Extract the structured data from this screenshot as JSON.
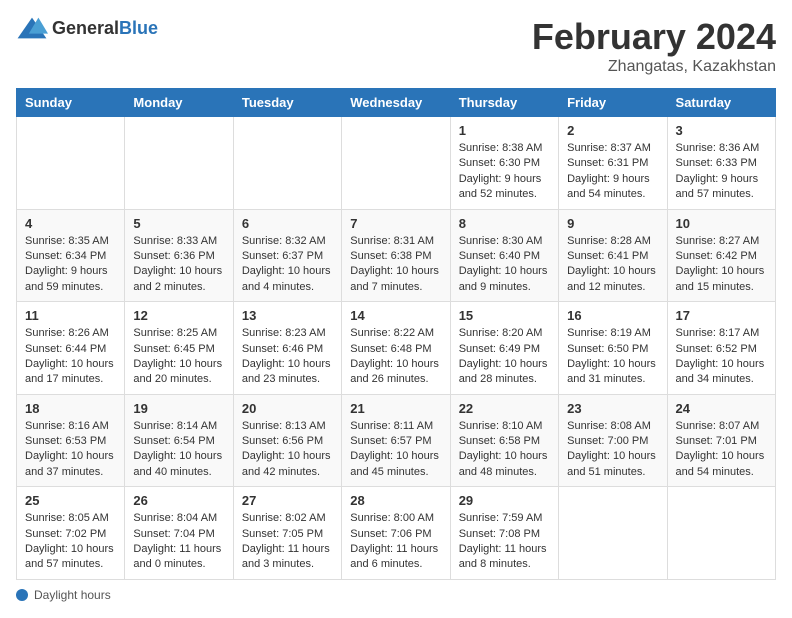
{
  "header": {
    "logo_general": "General",
    "logo_blue": "Blue",
    "title": "February 2024",
    "location": "Zhangatas, Kazakhstan"
  },
  "calendar": {
    "days_of_week": [
      "Sunday",
      "Monday",
      "Tuesday",
      "Wednesday",
      "Thursday",
      "Friday",
      "Saturday"
    ],
    "weeks": [
      [
        {
          "day": "",
          "info": ""
        },
        {
          "day": "",
          "info": ""
        },
        {
          "day": "",
          "info": ""
        },
        {
          "day": "",
          "info": ""
        },
        {
          "day": "1",
          "info": "Sunrise: 8:38 AM\nSunset: 6:30 PM\nDaylight: 9 hours and 52 minutes."
        },
        {
          "day": "2",
          "info": "Sunrise: 8:37 AM\nSunset: 6:31 PM\nDaylight: 9 hours and 54 minutes."
        },
        {
          "day": "3",
          "info": "Sunrise: 8:36 AM\nSunset: 6:33 PM\nDaylight: 9 hours and 57 minutes."
        }
      ],
      [
        {
          "day": "4",
          "info": "Sunrise: 8:35 AM\nSunset: 6:34 PM\nDaylight: 9 hours and 59 minutes."
        },
        {
          "day": "5",
          "info": "Sunrise: 8:33 AM\nSunset: 6:36 PM\nDaylight: 10 hours and 2 minutes."
        },
        {
          "day": "6",
          "info": "Sunrise: 8:32 AM\nSunset: 6:37 PM\nDaylight: 10 hours and 4 minutes."
        },
        {
          "day": "7",
          "info": "Sunrise: 8:31 AM\nSunset: 6:38 PM\nDaylight: 10 hours and 7 minutes."
        },
        {
          "day": "8",
          "info": "Sunrise: 8:30 AM\nSunset: 6:40 PM\nDaylight: 10 hours and 9 minutes."
        },
        {
          "day": "9",
          "info": "Sunrise: 8:28 AM\nSunset: 6:41 PM\nDaylight: 10 hours and 12 minutes."
        },
        {
          "day": "10",
          "info": "Sunrise: 8:27 AM\nSunset: 6:42 PM\nDaylight: 10 hours and 15 minutes."
        }
      ],
      [
        {
          "day": "11",
          "info": "Sunrise: 8:26 AM\nSunset: 6:44 PM\nDaylight: 10 hours and 17 minutes."
        },
        {
          "day": "12",
          "info": "Sunrise: 8:25 AM\nSunset: 6:45 PM\nDaylight: 10 hours and 20 minutes."
        },
        {
          "day": "13",
          "info": "Sunrise: 8:23 AM\nSunset: 6:46 PM\nDaylight: 10 hours and 23 minutes."
        },
        {
          "day": "14",
          "info": "Sunrise: 8:22 AM\nSunset: 6:48 PM\nDaylight: 10 hours and 26 minutes."
        },
        {
          "day": "15",
          "info": "Sunrise: 8:20 AM\nSunset: 6:49 PM\nDaylight: 10 hours and 28 minutes."
        },
        {
          "day": "16",
          "info": "Sunrise: 8:19 AM\nSunset: 6:50 PM\nDaylight: 10 hours and 31 minutes."
        },
        {
          "day": "17",
          "info": "Sunrise: 8:17 AM\nSunset: 6:52 PM\nDaylight: 10 hours and 34 minutes."
        }
      ],
      [
        {
          "day": "18",
          "info": "Sunrise: 8:16 AM\nSunset: 6:53 PM\nDaylight: 10 hours and 37 minutes."
        },
        {
          "day": "19",
          "info": "Sunrise: 8:14 AM\nSunset: 6:54 PM\nDaylight: 10 hours and 40 minutes."
        },
        {
          "day": "20",
          "info": "Sunrise: 8:13 AM\nSunset: 6:56 PM\nDaylight: 10 hours and 42 minutes."
        },
        {
          "day": "21",
          "info": "Sunrise: 8:11 AM\nSunset: 6:57 PM\nDaylight: 10 hours and 45 minutes."
        },
        {
          "day": "22",
          "info": "Sunrise: 8:10 AM\nSunset: 6:58 PM\nDaylight: 10 hours and 48 minutes."
        },
        {
          "day": "23",
          "info": "Sunrise: 8:08 AM\nSunset: 7:00 PM\nDaylight: 10 hours and 51 minutes."
        },
        {
          "day": "24",
          "info": "Sunrise: 8:07 AM\nSunset: 7:01 PM\nDaylight: 10 hours and 54 minutes."
        }
      ],
      [
        {
          "day": "25",
          "info": "Sunrise: 8:05 AM\nSunset: 7:02 PM\nDaylight: 10 hours and 57 minutes."
        },
        {
          "day": "26",
          "info": "Sunrise: 8:04 AM\nSunset: 7:04 PM\nDaylight: 11 hours and 0 minutes."
        },
        {
          "day": "27",
          "info": "Sunrise: 8:02 AM\nSunset: 7:05 PM\nDaylight: 11 hours and 3 minutes."
        },
        {
          "day": "28",
          "info": "Sunrise: 8:00 AM\nSunset: 7:06 PM\nDaylight: 11 hours and 6 minutes."
        },
        {
          "day": "29",
          "info": "Sunrise: 7:59 AM\nSunset: 7:08 PM\nDaylight: 11 hours and 8 minutes."
        },
        {
          "day": "",
          "info": ""
        },
        {
          "day": "",
          "info": ""
        }
      ]
    ]
  },
  "footer": {
    "daylight_label": "Daylight hours"
  }
}
